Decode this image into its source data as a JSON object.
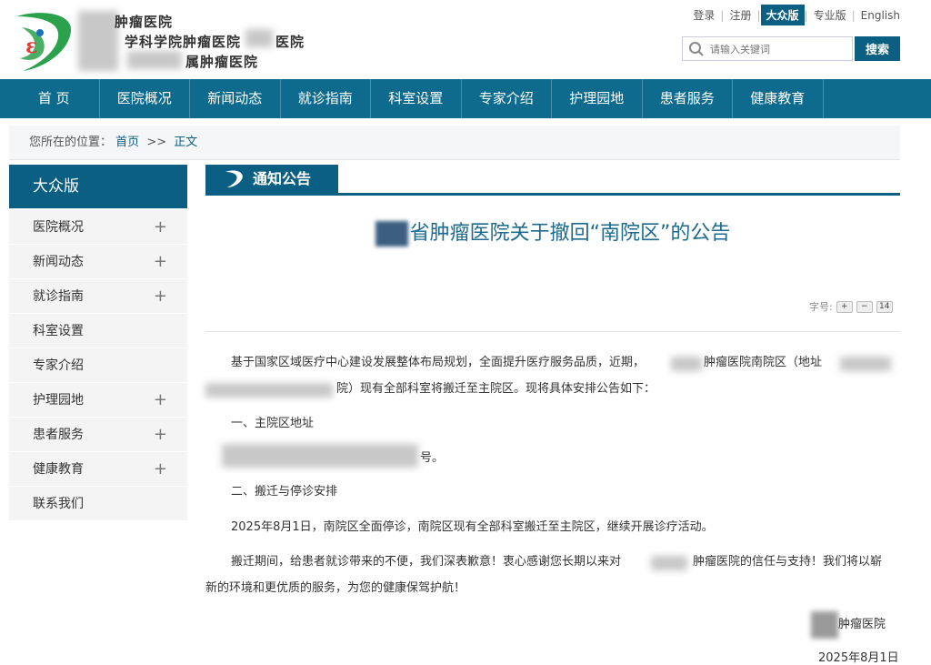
{
  "header": {
    "hospital_lines": [
      "肿瘤医院",
      "学科学院肿瘤医院",
      "医院",
      "属肿瘤医院"
    ],
    "top_links": [
      "登录",
      "注册",
      "大众版",
      "专业版",
      "English"
    ],
    "active_version": "大众版",
    "search_placeholder": "请输入关键词",
    "search_button": "搜索",
    "brand_colors": {
      "primary": "#0b5f83",
      "nav": "#0e6b8e",
      "logo_green": "#2aa14a",
      "logo_red": "#e03c31"
    }
  },
  "nav": [
    "首 页",
    "医院概况",
    "新闻动态",
    "就诊指南",
    "科室设置",
    "专家介绍",
    "护理园地",
    "患者服务",
    "健康教育"
  ],
  "breadcrumb": {
    "label": "您所在的位置：",
    "home": "首页",
    "sep": ">>",
    "current": "正文"
  },
  "sidebar": {
    "title": "大众版",
    "items": [
      {
        "label": "医院概况",
        "expand": "+"
      },
      {
        "label": "新闻动态",
        "expand": "+"
      },
      {
        "label": "就诊指南",
        "expand": "+"
      },
      {
        "label": "科室设置",
        "expand": ""
      },
      {
        "label": "专家介绍",
        "expand": ""
      },
      {
        "label": "护理园地",
        "expand": "+"
      },
      {
        "label": "患者服务",
        "expand": "+"
      },
      {
        "label": "健康教育",
        "expand": "+"
      },
      {
        "label": "联系我们",
        "expand": ""
      }
    ]
  },
  "notice": {
    "section_title": "通知公告",
    "title": "省肿瘤医院关于撤回“南院区”的公告",
    "font_size_label": "字号:",
    "font_size_plus": "+",
    "font_size_minus": "−",
    "font_size_value": "14",
    "p1a": "基于国家区域医疗中心建设发展整体布局规划，全面提升医疗服务品质，近期，",
    "p1b": "肿瘤医院南院区（地址",
    "p2": "院）现有全部科室将搬迁至主院区。现将具体安排公告如下：",
    "h1": "一、主院区地址",
    "addr_tail": "号。",
    "h2": "二、搬迁与停诊安排",
    "p3": "2025年8月1日，南院区全面停诊，南院区现有全部科室搬迁至主院区，继续开展诊疗活动。",
    "p4a": "搬迁期间，给患者就诊带来的不便，我们深表歉意！衷心感谢您长期以来对",
    "p4b": "肿瘤医院的信任与支持！我们将以崭",
    "p5": "新的环境和更优质的服务，为您的健康保驾护航！",
    "sign_org": "肿瘤医院",
    "sign_date": "2025年8月1日"
  }
}
